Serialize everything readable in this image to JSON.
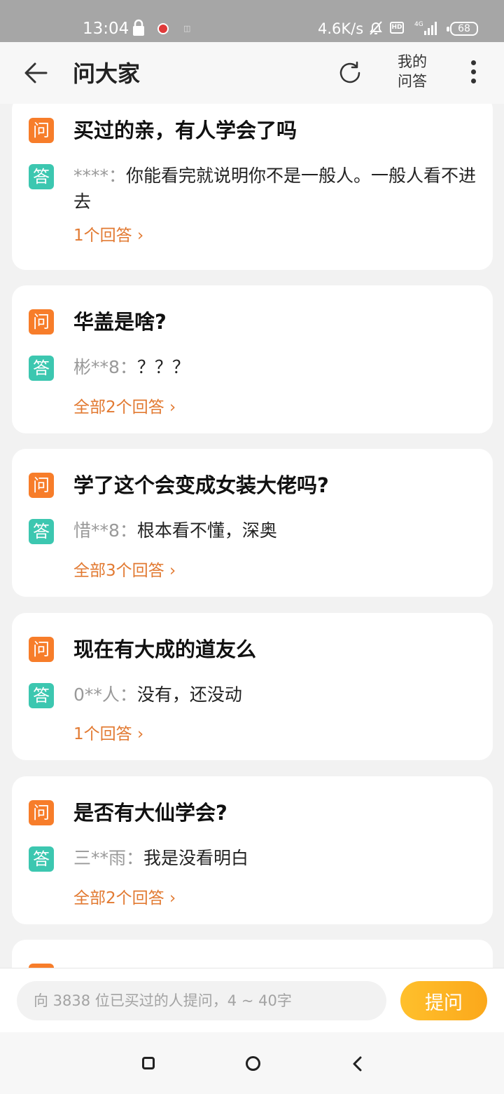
{
  "status_bar": {
    "time": "13:04",
    "speed": "4.6K/s",
    "network": "4G",
    "hd": "HD",
    "battery": "68"
  },
  "header": {
    "title": "问大家",
    "my_qa_line1": "我的",
    "my_qa_line2": "问答"
  },
  "labels": {
    "question_tag": "问",
    "answer_tag": "答"
  },
  "questions": [
    {
      "question": "买过的亲，有人学会了吗",
      "user": "****：",
      "answer": "你能看完就说明你不是一般人。一般人看不进去",
      "link": "1个回答"
    },
    {
      "question": "华盖是啥?",
      "user": "彬**8：",
      "answer": "？？？",
      "link": "全部2个回答"
    },
    {
      "question": "学了这个会变成女装大佬吗?",
      "user": "惜**8：",
      "answer": "根本看不懂，深奥",
      "link": "全部3个回答"
    },
    {
      "question": "现在有大成的道友么",
      "user": "0**人：",
      "answer": "没有，还没动",
      "link": "1个回答"
    },
    {
      "question": "是否有大仙学会?",
      "user": "三**雨：",
      "answer": "我是没看明白",
      "link": "全部2个回答"
    }
  ],
  "ask": {
    "placeholder": "向 3838 位已买过的人提问，4 ~ 40字",
    "button": "提问"
  },
  "colors": {
    "question_tag": "#f77d2a",
    "answer_tag": "#3cc7b0",
    "link": "#e27a32",
    "ask_button": "#fdb321"
  }
}
